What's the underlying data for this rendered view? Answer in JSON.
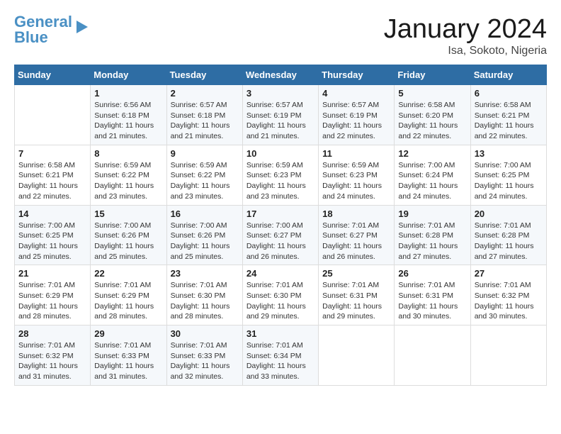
{
  "logo": {
    "line1": "General",
    "line2": "Blue"
  },
  "title": "January 2024",
  "subtitle": "Isa, Sokoto, Nigeria",
  "days_header": [
    "Sunday",
    "Monday",
    "Tuesday",
    "Wednesday",
    "Thursday",
    "Friday",
    "Saturday"
  ],
  "weeks": [
    [
      {
        "num": "",
        "lines": []
      },
      {
        "num": "1",
        "lines": [
          "Sunrise: 6:56 AM",
          "Sunset: 6:18 PM",
          "Daylight: 11 hours",
          "and 21 minutes."
        ]
      },
      {
        "num": "2",
        "lines": [
          "Sunrise: 6:57 AM",
          "Sunset: 6:18 PM",
          "Daylight: 11 hours",
          "and 21 minutes."
        ]
      },
      {
        "num": "3",
        "lines": [
          "Sunrise: 6:57 AM",
          "Sunset: 6:19 PM",
          "Daylight: 11 hours",
          "and 21 minutes."
        ]
      },
      {
        "num": "4",
        "lines": [
          "Sunrise: 6:57 AM",
          "Sunset: 6:19 PM",
          "Daylight: 11 hours",
          "and 22 minutes."
        ]
      },
      {
        "num": "5",
        "lines": [
          "Sunrise: 6:58 AM",
          "Sunset: 6:20 PM",
          "Daylight: 11 hours",
          "and 22 minutes."
        ]
      },
      {
        "num": "6",
        "lines": [
          "Sunrise: 6:58 AM",
          "Sunset: 6:21 PM",
          "Daylight: 11 hours",
          "and 22 minutes."
        ]
      }
    ],
    [
      {
        "num": "7",
        "lines": [
          "Sunrise: 6:58 AM",
          "Sunset: 6:21 PM",
          "Daylight: 11 hours",
          "and 22 minutes."
        ]
      },
      {
        "num": "8",
        "lines": [
          "Sunrise: 6:59 AM",
          "Sunset: 6:22 PM",
          "Daylight: 11 hours",
          "and 23 minutes."
        ]
      },
      {
        "num": "9",
        "lines": [
          "Sunrise: 6:59 AM",
          "Sunset: 6:22 PM",
          "Daylight: 11 hours",
          "and 23 minutes."
        ]
      },
      {
        "num": "10",
        "lines": [
          "Sunrise: 6:59 AM",
          "Sunset: 6:23 PM",
          "Daylight: 11 hours",
          "and 23 minutes."
        ]
      },
      {
        "num": "11",
        "lines": [
          "Sunrise: 6:59 AM",
          "Sunset: 6:23 PM",
          "Daylight: 11 hours",
          "and 24 minutes."
        ]
      },
      {
        "num": "12",
        "lines": [
          "Sunrise: 7:00 AM",
          "Sunset: 6:24 PM",
          "Daylight: 11 hours",
          "and 24 minutes."
        ]
      },
      {
        "num": "13",
        "lines": [
          "Sunrise: 7:00 AM",
          "Sunset: 6:25 PM",
          "Daylight: 11 hours",
          "and 24 minutes."
        ]
      }
    ],
    [
      {
        "num": "14",
        "lines": [
          "Sunrise: 7:00 AM",
          "Sunset: 6:25 PM",
          "Daylight: 11 hours",
          "and 25 minutes."
        ]
      },
      {
        "num": "15",
        "lines": [
          "Sunrise: 7:00 AM",
          "Sunset: 6:26 PM",
          "Daylight: 11 hours",
          "and 25 minutes."
        ]
      },
      {
        "num": "16",
        "lines": [
          "Sunrise: 7:00 AM",
          "Sunset: 6:26 PM",
          "Daylight: 11 hours",
          "and 25 minutes."
        ]
      },
      {
        "num": "17",
        "lines": [
          "Sunrise: 7:00 AM",
          "Sunset: 6:27 PM",
          "Daylight: 11 hours",
          "and 26 minutes."
        ]
      },
      {
        "num": "18",
        "lines": [
          "Sunrise: 7:01 AM",
          "Sunset: 6:27 PM",
          "Daylight: 11 hours",
          "and 26 minutes."
        ]
      },
      {
        "num": "19",
        "lines": [
          "Sunrise: 7:01 AM",
          "Sunset: 6:28 PM",
          "Daylight: 11 hours",
          "and 27 minutes."
        ]
      },
      {
        "num": "20",
        "lines": [
          "Sunrise: 7:01 AM",
          "Sunset: 6:28 PM",
          "Daylight: 11 hours",
          "and 27 minutes."
        ]
      }
    ],
    [
      {
        "num": "21",
        "lines": [
          "Sunrise: 7:01 AM",
          "Sunset: 6:29 PM",
          "Daylight: 11 hours",
          "and 28 minutes."
        ]
      },
      {
        "num": "22",
        "lines": [
          "Sunrise: 7:01 AM",
          "Sunset: 6:29 PM",
          "Daylight: 11 hours",
          "and 28 minutes."
        ]
      },
      {
        "num": "23",
        "lines": [
          "Sunrise: 7:01 AM",
          "Sunset: 6:30 PM",
          "Daylight: 11 hours",
          "and 28 minutes."
        ]
      },
      {
        "num": "24",
        "lines": [
          "Sunrise: 7:01 AM",
          "Sunset: 6:30 PM",
          "Daylight: 11 hours",
          "and 29 minutes."
        ]
      },
      {
        "num": "25",
        "lines": [
          "Sunrise: 7:01 AM",
          "Sunset: 6:31 PM",
          "Daylight: 11 hours",
          "and 29 minutes."
        ]
      },
      {
        "num": "26",
        "lines": [
          "Sunrise: 7:01 AM",
          "Sunset: 6:31 PM",
          "Daylight: 11 hours",
          "and 30 minutes."
        ]
      },
      {
        "num": "27",
        "lines": [
          "Sunrise: 7:01 AM",
          "Sunset: 6:32 PM",
          "Daylight: 11 hours",
          "and 30 minutes."
        ]
      }
    ],
    [
      {
        "num": "28",
        "lines": [
          "Sunrise: 7:01 AM",
          "Sunset: 6:32 PM",
          "Daylight: 11 hours",
          "and 31 minutes."
        ]
      },
      {
        "num": "29",
        "lines": [
          "Sunrise: 7:01 AM",
          "Sunset: 6:33 PM",
          "Daylight: 11 hours",
          "and 31 minutes."
        ]
      },
      {
        "num": "30",
        "lines": [
          "Sunrise: 7:01 AM",
          "Sunset: 6:33 PM",
          "Daylight: 11 hours",
          "and 32 minutes."
        ]
      },
      {
        "num": "31",
        "lines": [
          "Sunrise: 7:01 AM",
          "Sunset: 6:34 PM",
          "Daylight: 11 hours",
          "and 33 minutes."
        ]
      },
      {
        "num": "",
        "lines": []
      },
      {
        "num": "",
        "lines": []
      },
      {
        "num": "",
        "lines": []
      }
    ]
  ]
}
